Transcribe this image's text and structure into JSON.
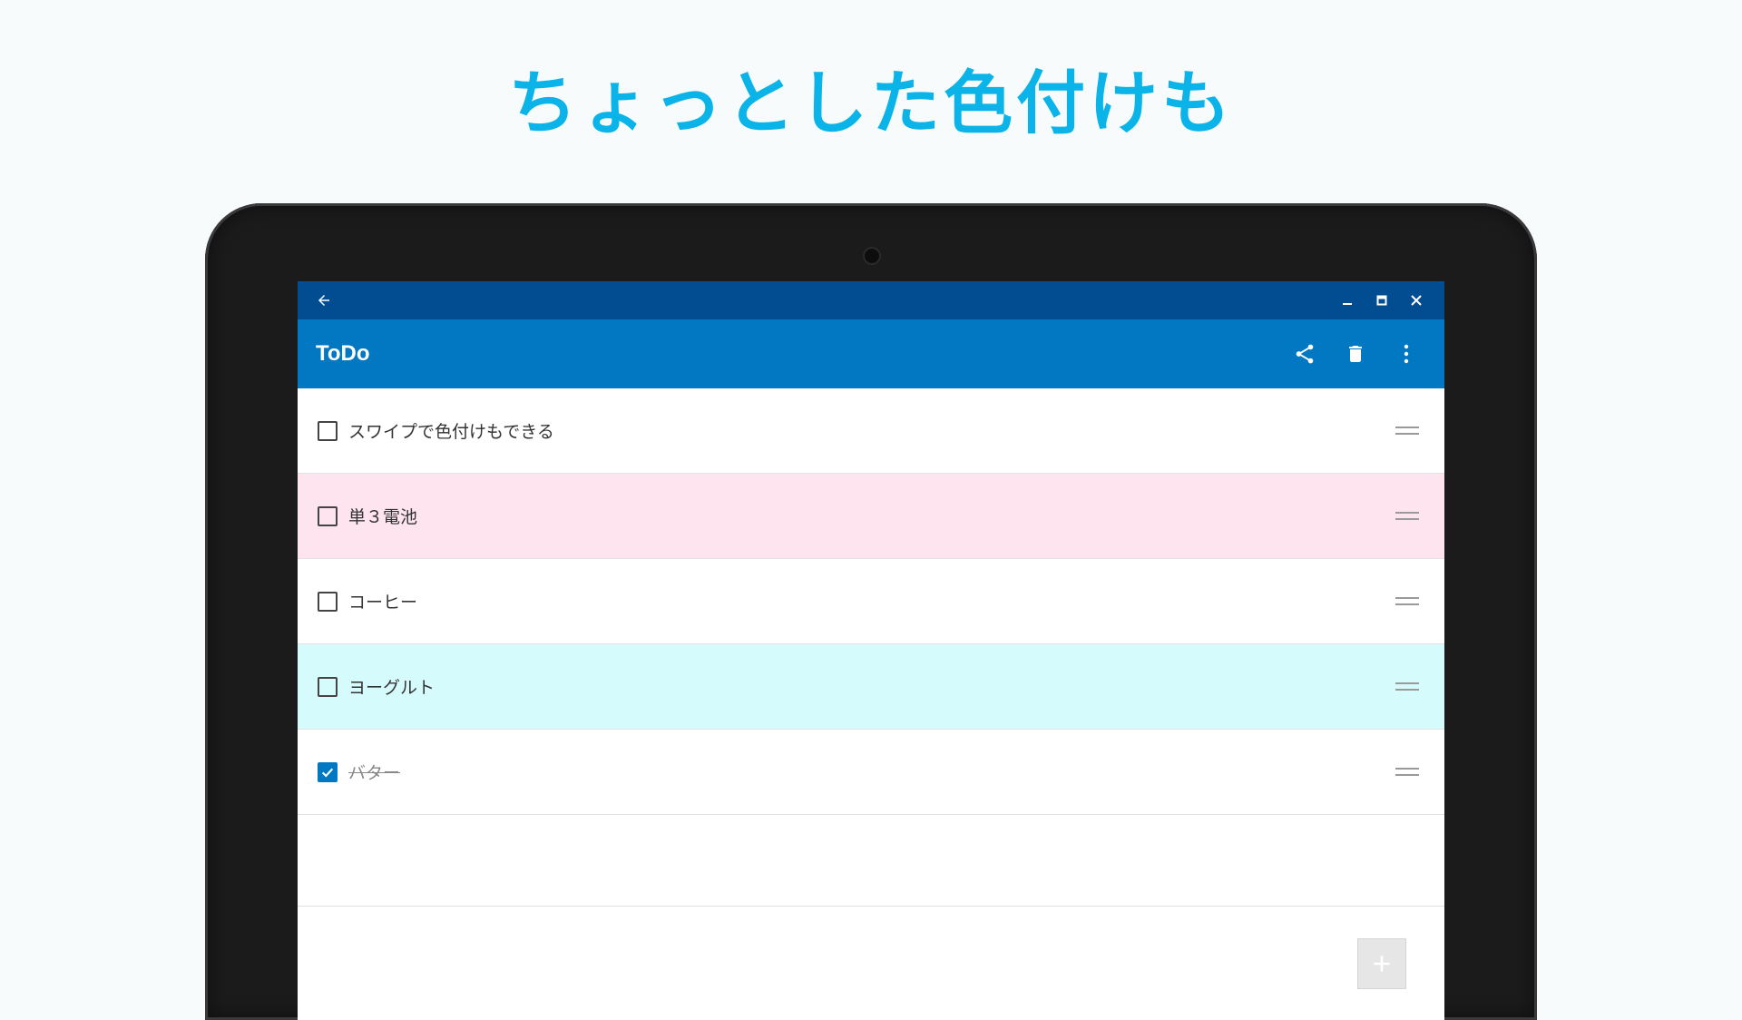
{
  "headline": "ちょっとした色付けも",
  "colors": {
    "accent": "#0ab4e8",
    "titlebar": "#024d92",
    "appbar": "#0277c2",
    "pink_row": "#fde4ef",
    "cyan_row": "#d6fbfd",
    "white_row": "#ffffff"
  },
  "window": {
    "back_icon": "arrow-left-icon",
    "controls": [
      "minimize-icon",
      "maximize-icon",
      "close-icon"
    ]
  },
  "app": {
    "title": "ToDo",
    "actions": [
      "share-icon",
      "delete-icon",
      "more-vertical-icon"
    ]
  },
  "items": [
    {
      "label": "スワイプで色付けもできる",
      "checked": false,
      "color": "#ffffff"
    },
    {
      "label": "単３電池",
      "checked": false,
      "color": "#fde4ef"
    },
    {
      "label": "コーヒー",
      "checked": false,
      "color": "#ffffff"
    },
    {
      "label": "ヨーグルト",
      "checked": false,
      "color": "#d6fbfd"
    },
    {
      "label": "バター",
      "checked": true,
      "color": "#ffffff"
    }
  ],
  "fab": {
    "icon": "plus-icon"
  }
}
